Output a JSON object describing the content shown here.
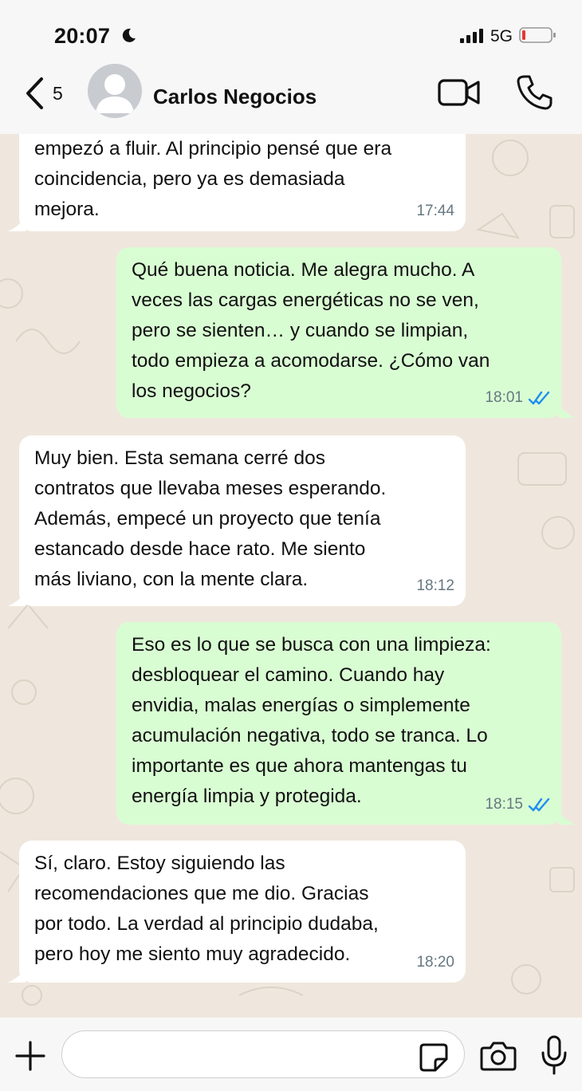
{
  "status_bar": {
    "time": "20:07",
    "network": "5G",
    "icons": [
      "moon-icon",
      "signal-icon",
      "battery-low-icon"
    ],
    "battery_color": "#e53935"
  },
  "header": {
    "back_count": "5",
    "contact_name": "Carlos Negocios",
    "icons": [
      "chevron-left-icon",
      "avatar-placeholder-icon",
      "video-camera-icon",
      "phone-icon"
    ]
  },
  "colors": {
    "incoming_bubble": "#ffffff",
    "outgoing_bubble": "#d9fdd3",
    "read_ticks": "#1f8ef1",
    "chat_background": "#efe7dd"
  },
  "messages": [
    {
      "direction": "in",
      "text": "empezó a fluir. Al principio pensé que era\ncoincidencia, pero ya es demasiada\nmejora.",
      "time": "17:44"
    },
    {
      "direction": "out",
      "text": "Qué buena noticia. Me alegra mucho. A\nveces las cargas energéticas no se ven,\npero se sienten… y cuando se limpian,\ntodo empieza a acomodarse. ¿Cómo van\nlos negocios?",
      "time": "18:01",
      "status": "read"
    },
    {
      "direction": "in",
      "text": "Muy bien. Esta semana cerré dos\ncontratos que llevaba meses esperando.\nAdemás, empecé un proyecto que tenía\nestancado desde hace rato. Me siento\nmás liviano, con la mente clara.",
      "time": "18:12"
    },
    {
      "direction": "out",
      "text": "Eso es lo que se busca con una limpieza:\ndesbloquear el camino. Cuando hay\nenvidia, malas energías o simplemente\nacumulación negativa, todo se tranca. Lo\nimportante es que ahora mantengas tu\nenergía limpia y protegida.",
      "time": "18:15",
      "status": "read"
    },
    {
      "direction": "in",
      "text": "Sí, claro. Estoy siguiendo las\nrecomendaciones que me dio. Gracias\npor todo. La verdad al principio dudaba,\npero hoy me siento muy agradecido.",
      "time": "18:20"
    }
  ],
  "composer": {
    "input_value": "",
    "icons": [
      "plus-icon",
      "sticker-icon",
      "camera-icon",
      "microphone-icon"
    ]
  }
}
